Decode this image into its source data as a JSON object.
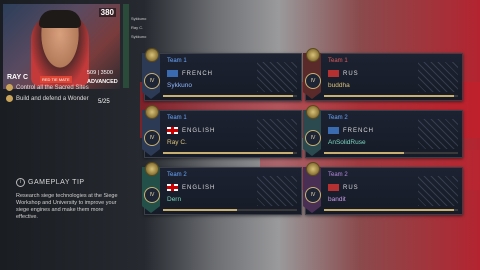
{
  "webcam": {
    "timer": "380",
    "streamer_tag": "RAY C",
    "badge": "RED TIE MATE",
    "score": "509 | 3500",
    "sponsor": "ADVANCED"
  },
  "mini_list": [
    "Sykkuno",
    "Ray C.",
    "Sykkuno"
  ],
  "objectives": [
    {
      "label": "Control all the Sacred Sites"
    },
    {
      "label": "Build and defend a Wonder"
    }
  ],
  "objective_count": "5/25",
  "tip": {
    "title": "GAMEPLAY TIP",
    "body": "Research siege technologies at the Siege Workshop and University to improve your siege engines and make them more effective."
  },
  "cards": [
    {
      "team": "Team 1",
      "civ": "FRENCH",
      "flag": "fr",
      "player": "Sykkuno",
      "tier": "IV",
      "progress": 0.97
    },
    {
      "team": "Team 1",
      "civ": "RUS",
      "flag": "rus",
      "player": "buddha",
      "tier": "IV",
      "progress": 0.97
    },
    {
      "team": "Team 1",
      "civ": "ENGLISH",
      "flag": "en",
      "player": "Ray C.",
      "tier": "IV",
      "progress": 0.97
    },
    {
      "team": "Team 2",
      "civ": "FRENCH",
      "flag": "fr",
      "player": "AnSolidRuse",
      "tier": "IV",
      "progress": 0.6
    },
    {
      "team": "Team 2",
      "civ": "ENGLISH",
      "flag": "en",
      "player": "Dern",
      "tier": "IV",
      "progress": 0.55
    },
    {
      "team": "Team 2",
      "civ": "RUS",
      "flag": "rus",
      "player": "bandit",
      "tier": "IV",
      "progress": 0.97
    }
  ]
}
